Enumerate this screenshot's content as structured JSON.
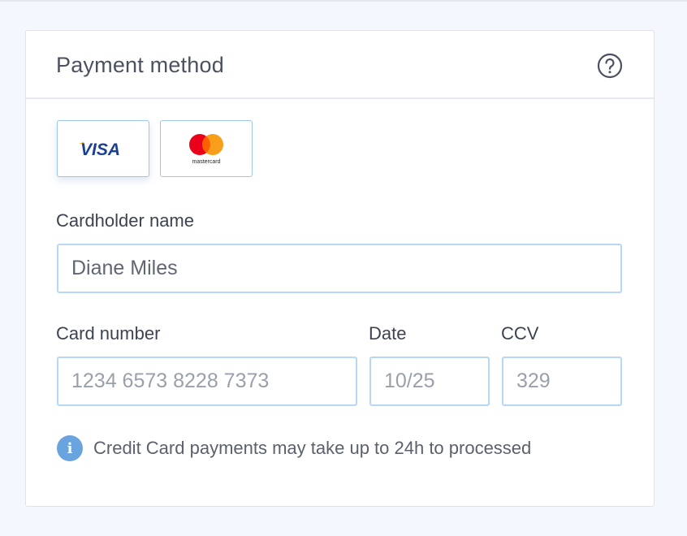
{
  "payment": {
    "title": "Payment method",
    "help_icon": "help-circle-icon",
    "methods": [
      {
        "name": "VISA",
        "icon": "visa-logo",
        "selected": true
      },
      {
        "name": "mastercard",
        "icon": "mastercard-logo",
        "selected": false
      }
    ],
    "cardholder": {
      "label": "Cardholder name",
      "value": "Diane Miles"
    },
    "card_number": {
      "label": "Card number",
      "placeholder": "1234 6573 8228 7373"
    },
    "date": {
      "label": "Date",
      "placeholder": "10/25"
    },
    "ccv": {
      "label": "CCV",
      "placeholder": "329"
    },
    "info": {
      "icon": "info-icon",
      "glyph": "i",
      "text": "Credit Card payments may take up to 24h to processed"
    }
  },
  "colors": {
    "background": "#f4f7fd",
    "field_border": "#b6d7f5",
    "visa_blue": "#1a3f93",
    "visa_gold": "#f2a900",
    "mc_red": "#eb001b",
    "mc_orange": "#f79e1b",
    "info_blue": "#6aa4de"
  }
}
